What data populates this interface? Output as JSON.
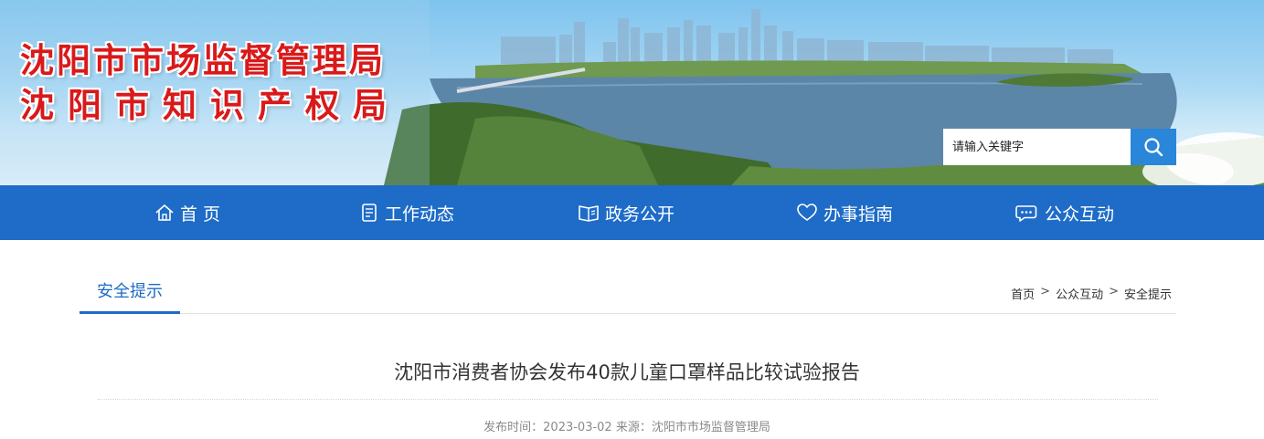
{
  "header": {
    "title_line1": "沈阳市市场监督管理局",
    "title_line2": "沈阳市知识产权局"
  },
  "search": {
    "placeholder": "请输入关键字",
    "button_icon": "search-icon"
  },
  "nav": {
    "items": [
      {
        "label": "首 页",
        "icon": "home-icon"
      },
      {
        "label": "工作动态",
        "icon": "document-icon"
      },
      {
        "label": "政务公开",
        "icon": "open-book-icon"
      },
      {
        "label": "办事指南",
        "icon": "heart-icon"
      },
      {
        "label": "公众互动",
        "icon": "chat-bubble-icon"
      }
    ]
  },
  "section": {
    "tab_label": "安全提示"
  },
  "breadcrumb": {
    "items": [
      "首页",
      "公众互动",
      "安全提示"
    ],
    "separator": ">"
  },
  "article": {
    "title": "沈阳市消费者协会发布40款儿童口罩样品比较试验报告",
    "meta": "发布时间：2023-03-02 来源：沈阳市市场监督管理局"
  },
  "colors": {
    "brand_blue": "#1e6cc7",
    "title_red": "#d9191a",
    "search_button": "#2a86d8"
  }
}
